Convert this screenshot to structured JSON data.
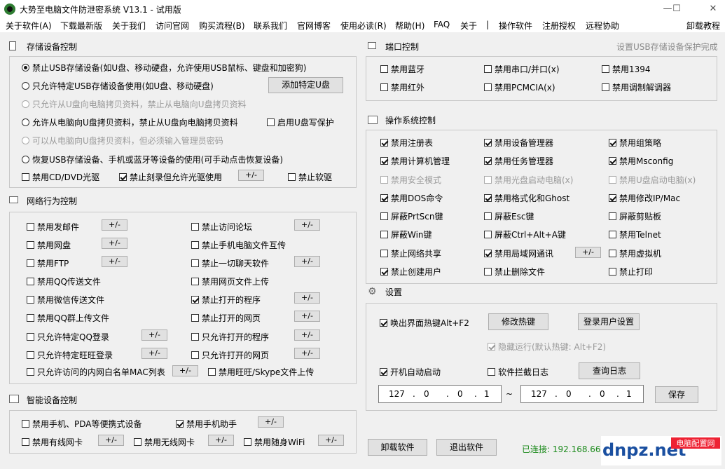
{
  "window": {
    "title": "大势至电脑文件防泄密系统 V13.1 - 试用版",
    "min": "—",
    "max": "☐",
    "close": "✕"
  },
  "menu": [
    "关于软件(A)",
    "下载最新版",
    "关于我们",
    "访问官网",
    "购买流程(B)",
    "联系我们",
    "官网博客",
    "使用必读(R)",
    "帮助(H)",
    "FAQ",
    "关于",
    "|",
    "操作软件",
    "注册授权",
    "远程协助",
    "卸载教程"
  ],
  "storage": {
    "title": "存储设备控制",
    "radios": [
      {
        "label": "禁止USB存储设备(如U盘、移动硬盘，允许使用USB鼠标、键盘和加密狗)",
        "checked": true,
        "disabled": false
      },
      {
        "label": "只允许特定USB存储设备使用(如U盘、移动硬盘)",
        "checked": false,
        "disabled": false
      },
      {
        "label": "只允许从U盘向电脑拷贝资料，禁止从电脑向U盘拷贝资料",
        "checked": false,
        "disabled": true
      },
      {
        "label": "允许从电脑向U盘拷贝资料，禁止从U盘向电脑拷贝资料",
        "checked": false,
        "disabled": false
      },
      {
        "label": "可以从电脑向U盘拷贝资料，但必须输入管理员密码",
        "checked": false,
        "disabled": true
      },
      {
        "label": "恢复USB存储设备、手机或蓝牙等设备的使用(可手动点击恢复设备)",
        "checked": false,
        "disabled": false
      }
    ],
    "add_button": "添加特定U盘",
    "write_protect": {
      "label": "启用U盘写保护",
      "checked": false
    },
    "cd": {
      "label": "禁用CD/DVD光驱",
      "checked": false
    },
    "burn": {
      "label": "禁止刻录但允许光驱使用",
      "checked": true
    },
    "floppy": {
      "label": "禁止软驱",
      "checked": false
    }
  },
  "network": {
    "title": "网络行为控制",
    "left": [
      {
        "label": "禁用发邮件",
        "checked": false
      },
      {
        "label": "禁用网盘",
        "checked": false
      },
      {
        "label": "禁用FTP",
        "checked": false
      },
      {
        "label": "禁用QQ传送文件",
        "checked": false
      },
      {
        "label": "禁用微信传送文件",
        "checked": false
      },
      {
        "label": "禁用QQ群上传文件",
        "checked": false
      },
      {
        "label": "只允许特定QQ登录",
        "checked": false
      },
      {
        "label": "只允许特定旺旺登录",
        "checked": false
      },
      {
        "label": "只允许访问的内网白名单MAC列表",
        "checked": false
      }
    ],
    "right": [
      {
        "label": "禁止访问论坛",
        "checked": false
      },
      {
        "label": "禁止手机电脑文件互传",
        "checked": false
      },
      {
        "label": "禁止一切聊天软件",
        "checked": false
      },
      {
        "label": "禁用网页文件上传",
        "checked": false
      },
      {
        "label": "禁止打开的程序",
        "checked": true
      },
      {
        "label": "禁止打开的网页",
        "checked": false
      },
      {
        "label": "只允许打开的程序",
        "checked": false
      },
      {
        "label": "只允许打开的网页",
        "checked": false
      },
      {
        "label": "禁用旺旺/Skype文件上传",
        "checked": false
      }
    ],
    "pm": "+/-"
  },
  "smart": {
    "title": "智能设备控制",
    "items": [
      {
        "label": "禁用手机、PDA等便携式设备",
        "checked": false
      },
      {
        "label": "禁用手机助手",
        "checked": true
      },
      {
        "label": "禁用有线网卡",
        "checked": false
      },
      {
        "label": "禁用无线网卡",
        "checked": false
      },
      {
        "label": "禁用随身WiFi",
        "checked": false
      }
    ]
  },
  "port": {
    "title": "端口控制",
    "hint": "设置USB存储设备保护完成",
    "items": [
      {
        "label": "禁用蓝牙",
        "checked": false
      },
      {
        "label": "禁用串口/并口(x)",
        "checked": false
      },
      {
        "label": "禁用1394",
        "checked": false
      },
      {
        "label": "禁用红外",
        "checked": false
      },
      {
        "label": "禁用PCMCIA(x)",
        "checked": false
      },
      {
        "label": "禁用调制解调器",
        "checked": false
      }
    ]
  },
  "os": {
    "title": "操作系统控制",
    "items": [
      {
        "label": "禁用注册表",
        "checked": true,
        "disabled": false
      },
      {
        "label": "禁用设备管理器",
        "checked": true,
        "disabled": false
      },
      {
        "label": "禁用组策略",
        "checked": true,
        "disabled": false
      },
      {
        "label": "禁用计算机管理",
        "checked": true,
        "disabled": false
      },
      {
        "label": "禁用任务管理器",
        "checked": true,
        "disabled": false
      },
      {
        "label": "禁用Msconfig",
        "checked": true,
        "disabled": false
      },
      {
        "label": "禁用安全模式",
        "checked": false,
        "disabled": true
      },
      {
        "label": "禁用光盘启动电脑(x)",
        "checked": false,
        "disabled": true
      },
      {
        "label": "禁用U盘启动电脑(x)",
        "checked": false,
        "disabled": true
      },
      {
        "label": "禁用DOS命令",
        "checked": true,
        "disabled": false
      },
      {
        "label": "禁用格式化和Ghost",
        "checked": true,
        "disabled": false
      },
      {
        "label": "禁用修改IP/Mac",
        "checked": true,
        "disabled": false
      },
      {
        "label": "屏蔽PrtScn键",
        "checked": false,
        "disabled": false
      },
      {
        "label": "屏蔽Esc键",
        "checked": false,
        "disabled": false
      },
      {
        "label": "屏蔽剪贴板",
        "checked": false,
        "disabled": false
      },
      {
        "label": "屏蔽Win键",
        "checked": false,
        "disabled": false
      },
      {
        "label": "屏蔽Ctrl+Alt+A键",
        "checked": false,
        "disabled": false
      },
      {
        "label": "禁用Telnet",
        "checked": false,
        "disabled": false
      },
      {
        "label": "禁止网络共享",
        "checked": false,
        "disabled": false
      },
      {
        "label": "禁用局域网通讯",
        "checked": true,
        "disabled": false
      },
      {
        "label": "禁用虚拟机",
        "checked": false,
        "disabled": false
      },
      {
        "label": "禁止创建用户",
        "checked": true,
        "disabled": false
      },
      {
        "label": "禁止删除文件",
        "checked": false,
        "disabled": false
      },
      {
        "label": "禁止打印",
        "checked": false,
        "disabled": false
      }
    ]
  },
  "settings": {
    "title": "设置",
    "hotkey": {
      "label": "唤出界面热键Alt+F2",
      "checked": true
    },
    "modify_hotkey": "修改热键",
    "login_user": "登录用户设置",
    "hidden": {
      "label": "隐藏运行(默认热键: Alt+F2)",
      "checked": true
    },
    "autostart": {
      "label": "开机自动启动",
      "checked": true
    },
    "intercept_log": {
      "label": "软件拦截日志",
      "checked": false
    },
    "query_log": "查询日志",
    "ip1": [
      "127",
      ".",
      "0",
      ".",
      "0",
      ".",
      "1"
    ],
    "tilde": "~",
    "ip2": [
      "127",
      ".",
      "0",
      ".",
      "0",
      ".",
      "1"
    ],
    "save": "保存"
  },
  "bottom": {
    "uninstall": "卸载软件",
    "exit": "退出软件",
    "status": "已连接: 192.168.66",
    "logo_text": "dnpz.net",
    "logo_cn": "电脑配置网"
  }
}
